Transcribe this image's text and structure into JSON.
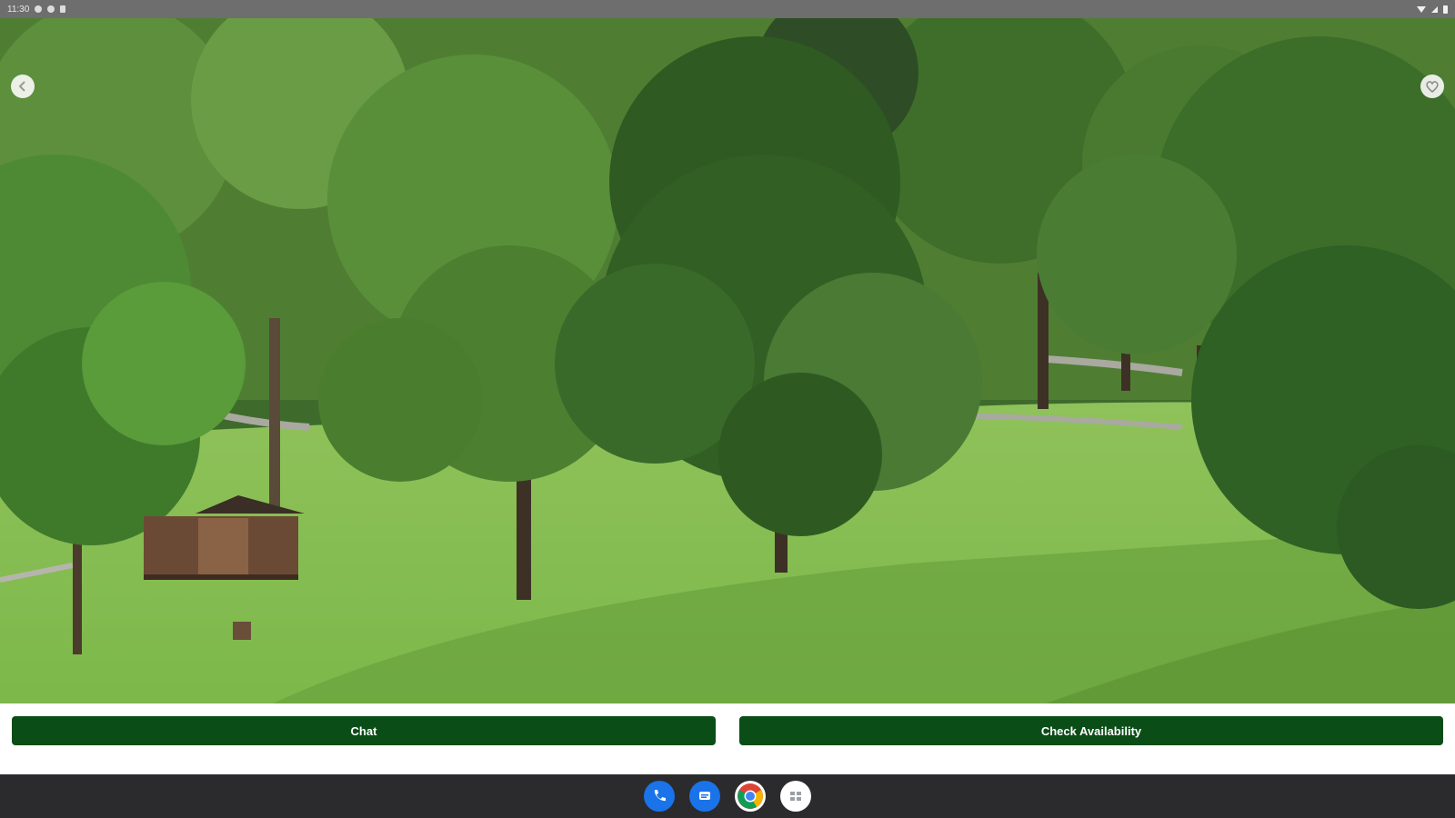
{
  "status_bar": {
    "time": "11:30"
  },
  "hero": {
    "back_icon": "chevron-left-icon",
    "favorite_icon": "heart-icon"
  },
  "actions": {
    "chat_label": "Chat",
    "check_availability_label": "Check Availability",
    "button_color": "#0b4d17"
  },
  "dock": {
    "apps": [
      "phone-icon",
      "messages-icon",
      "chrome-icon",
      "app-grid-icon"
    ]
  }
}
